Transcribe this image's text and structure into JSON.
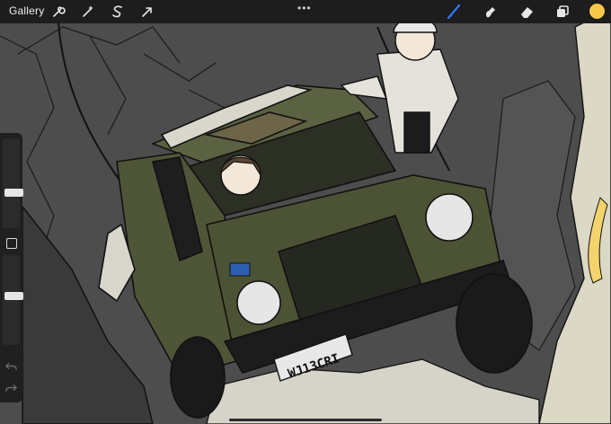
{
  "toolbar": {
    "gallery_label": "Gallery",
    "actions_icon": "wrench-icon",
    "adjustments_icon": "magic-wand-icon",
    "selection_icon": "selection-s-icon",
    "transform_icon": "arrow-cursor-icon",
    "more_label": "•••",
    "brush_icon": "brush-icon",
    "smudge_icon": "smudge-icon",
    "eraser_icon": "eraser-icon",
    "layers_icon": "layers-icon",
    "active_tool": "brush",
    "accent_color": "#2f7cf6",
    "current_color": "#f7c74a"
  },
  "sidebar": {
    "brush_size": 0.38,
    "brush_opacity": 0.55,
    "undo_icon": "undo-icon",
    "redo_icon": "redo-icon"
  },
  "artwork": {
    "plate_text": "WJ13CRI",
    "colors": {
      "rock": "#5a5a5a",
      "vehicle": "#4f5638",
      "vehicle_dark": "#3e4430",
      "snow": "#d9d7cc",
      "line": "#111111"
    }
  }
}
